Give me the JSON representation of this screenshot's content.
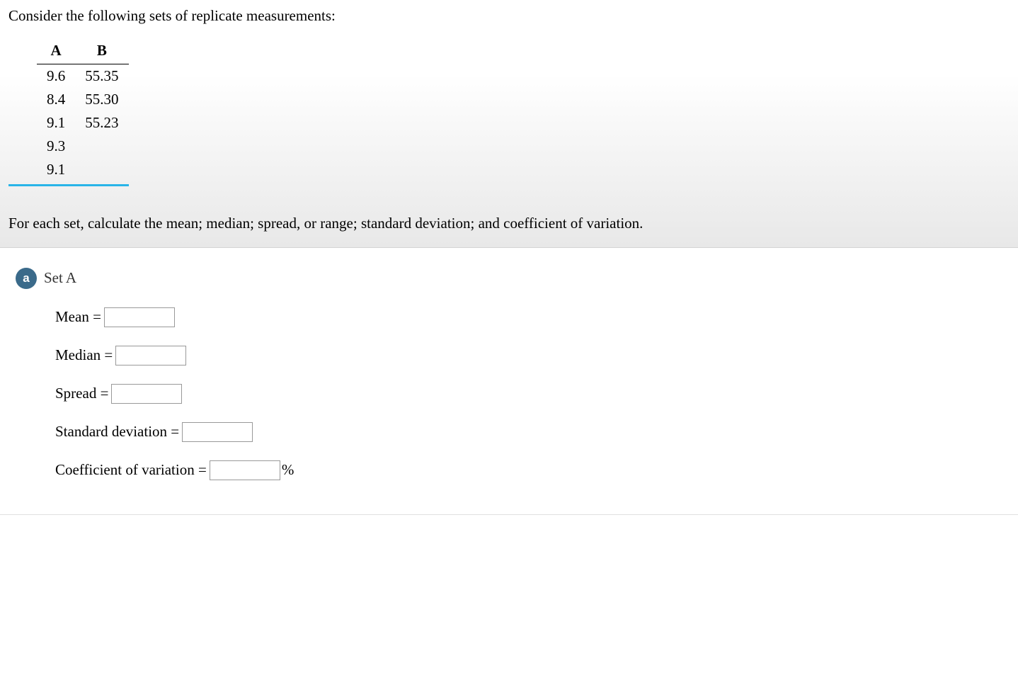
{
  "question": {
    "prompt": "Consider the following sets of replicate measurements:",
    "instruction": "For each set, calculate the mean; median; spread, or range; standard deviation; and coefficient of variation.",
    "table": {
      "headers": {
        "a": "A",
        "b": "B"
      },
      "rows": [
        {
          "a": "9.6",
          "b": "55.35"
        },
        {
          "a": "8.4",
          "b": "55.30"
        },
        {
          "a": "9.1",
          "b": "55.23"
        },
        {
          "a": "9.3",
          "b": ""
        },
        {
          "a": "9.1",
          "b": ""
        }
      ]
    }
  },
  "part": {
    "badge": "a",
    "title": "Set A",
    "fields": {
      "mean_label": "Mean =",
      "median_label": "Median =",
      "spread_label": "Spread =",
      "stddev_label": "Standard deviation =",
      "cov_label": "Coefficient of variation =",
      "cov_unit": "%"
    },
    "values": {
      "mean": "",
      "median": "",
      "spread": "",
      "stddev": "",
      "cov": ""
    }
  }
}
